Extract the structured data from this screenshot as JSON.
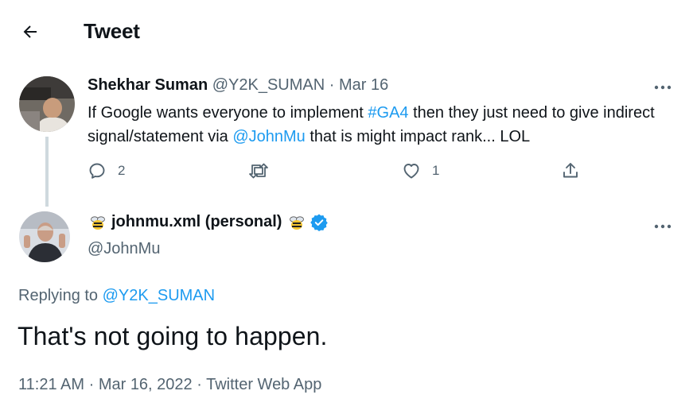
{
  "header": {
    "title": "Tweet",
    "back_icon": "arrow-left-icon"
  },
  "parent_tweet": {
    "display_name": "Shekhar Suman",
    "handle": "@Y2K_SUMAN",
    "separator": "·",
    "date": "Mar 16",
    "text_parts": [
      "If Google wants everyone to implement ",
      "#GA4",
      " then they just need to give indirect signal/statement via ",
      "@JohnMu",
      " that is might impact rank... LOL"
    ],
    "actions": {
      "reply_count": "2",
      "retweet_count": "",
      "like_count": "1"
    }
  },
  "main_tweet": {
    "display_name": "johnmu.xml (personal)",
    "handle": "@JohnMu",
    "replying_label": "Replying to ",
    "replying_handle": "@Y2K_SUMAN",
    "text": "That's not going to happen.",
    "time": "11:21 AM",
    "date": "Mar 16, 2022",
    "source": "Twitter Web App",
    "meta_separator": " · "
  },
  "colors": {
    "text": "#0f1419",
    "muted": "#536471",
    "link": "#1d9bf0",
    "verified": "#1d9bf0",
    "thread_line": "#cfd9de"
  }
}
